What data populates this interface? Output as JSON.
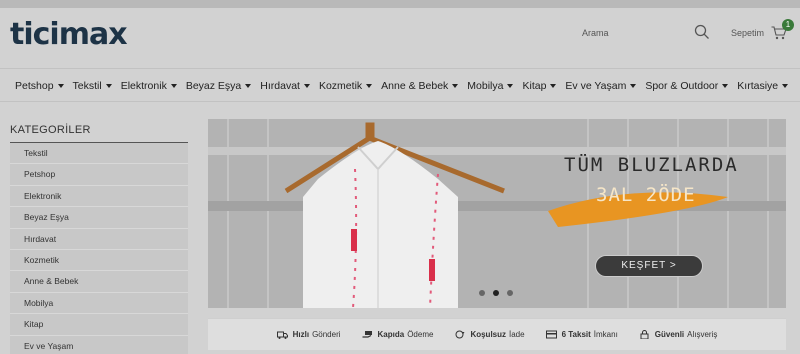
{
  "header": {
    "logo": "ticimax",
    "search_label": "Arama",
    "cart_label": "Sepetim",
    "cart_count": "1",
    "top_link": "· · ·"
  },
  "nav": {
    "items": [
      {
        "label": "Petshop"
      },
      {
        "label": "Tekstil"
      },
      {
        "label": "Elektronik"
      },
      {
        "label": "Beyaz Eşya"
      },
      {
        "label": "Hırdavat"
      },
      {
        "label": "Kozmetik"
      },
      {
        "label": "Anne & Bebek"
      },
      {
        "label": "Mobilya"
      },
      {
        "label": "Kitap"
      },
      {
        "label": "Ev ve Yaşam"
      },
      {
        "label": "Spor & Outdoor"
      },
      {
        "label": "Kırtasiye"
      }
    ]
  },
  "sidebar": {
    "title": "KATEGORİLER",
    "items": [
      {
        "label": "Tekstil"
      },
      {
        "label": "Petshop"
      },
      {
        "label": "Elektronik"
      },
      {
        "label": "Beyaz Eşya"
      },
      {
        "label": "Hırdavat"
      },
      {
        "label": "Kozmetik"
      },
      {
        "label": "Anne & Bebek"
      },
      {
        "label": "Mobilya"
      },
      {
        "label": "Kitap"
      },
      {
        "label": "Ev ve Yaşam"
      }
    ]
  },
  "banner": {
    "title": "TÜM BLUZLARDA",
    "subtitle": "3AL 2ÖDE",
    "button": "KEŞFET >",
    "slide_count": 3,
    "active_slide": 2,
    "accent_color": "#e89522"
  },
  "features": [
    {
      "bold": "Hızlı",
      "text": "Gönderi",
      "icon": "truck-icon"
    },
    {
      "bold": "Kapıda",
      "text": "Ödeme",
      "icon": "hand-cash-icon"
    },
    {
      "bold": "Koşulsuz",
      "text": "İade",
      "icon": "return-icon"
    },
    {
      "bold": "6 Taksit",
      "text": "İmkanı",
      "icon": "card-icon"
    },
    {
      "bold": "Güvenli",
      "text": "Alışveriş",
      "icon": "lock-icon"
    }
  ]
}
